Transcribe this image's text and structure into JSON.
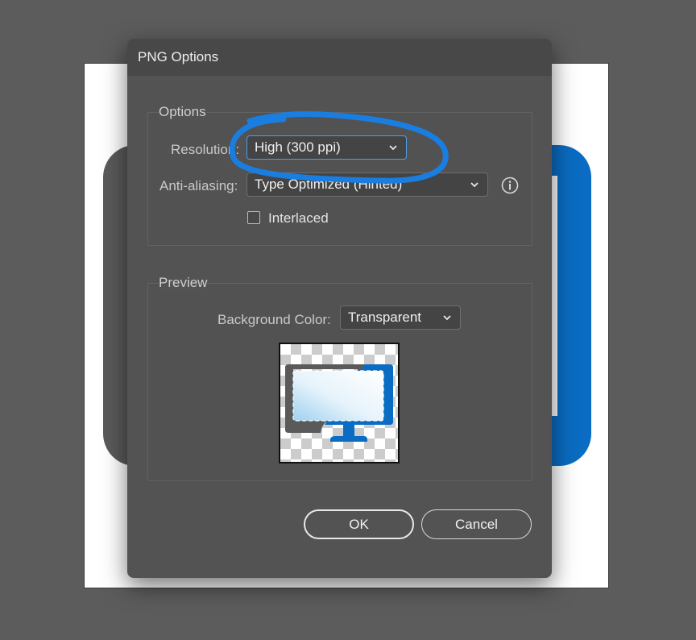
{
  "dialog": {
    "title": "PNG Options",
    "options_group": {
      "title": "Options",
      "resolution_label": "Resolution:",
      "resolution_value": "High (300 ppi)",
      "antialiasing_label": "Anti-aliasing:",
      "antialiasing_value": "Type Optimized (Hinted)",
      "interlaced_label": "Interlaced",
      "interlaced_checked": false
    },
    "preview_group": {
      "title": "Preview",
      "background_color_label": "Background Color:",
      "background_color_value": "Transparent"
    },
    "buttons": {
      "ok": "OK",
      "cancel": "Cancel"
    }
  },
  "icons": {
    "dropdown": "chevron-down-icon",
    "info": "info-icon",
    "preview": "monitor-icon"
  },
  "colors": {
    "dialog_bg": "#535353",
    "accent_blue": "#0a6cc2",
    "annotation_blue": "#1a7de0"
  }
}
